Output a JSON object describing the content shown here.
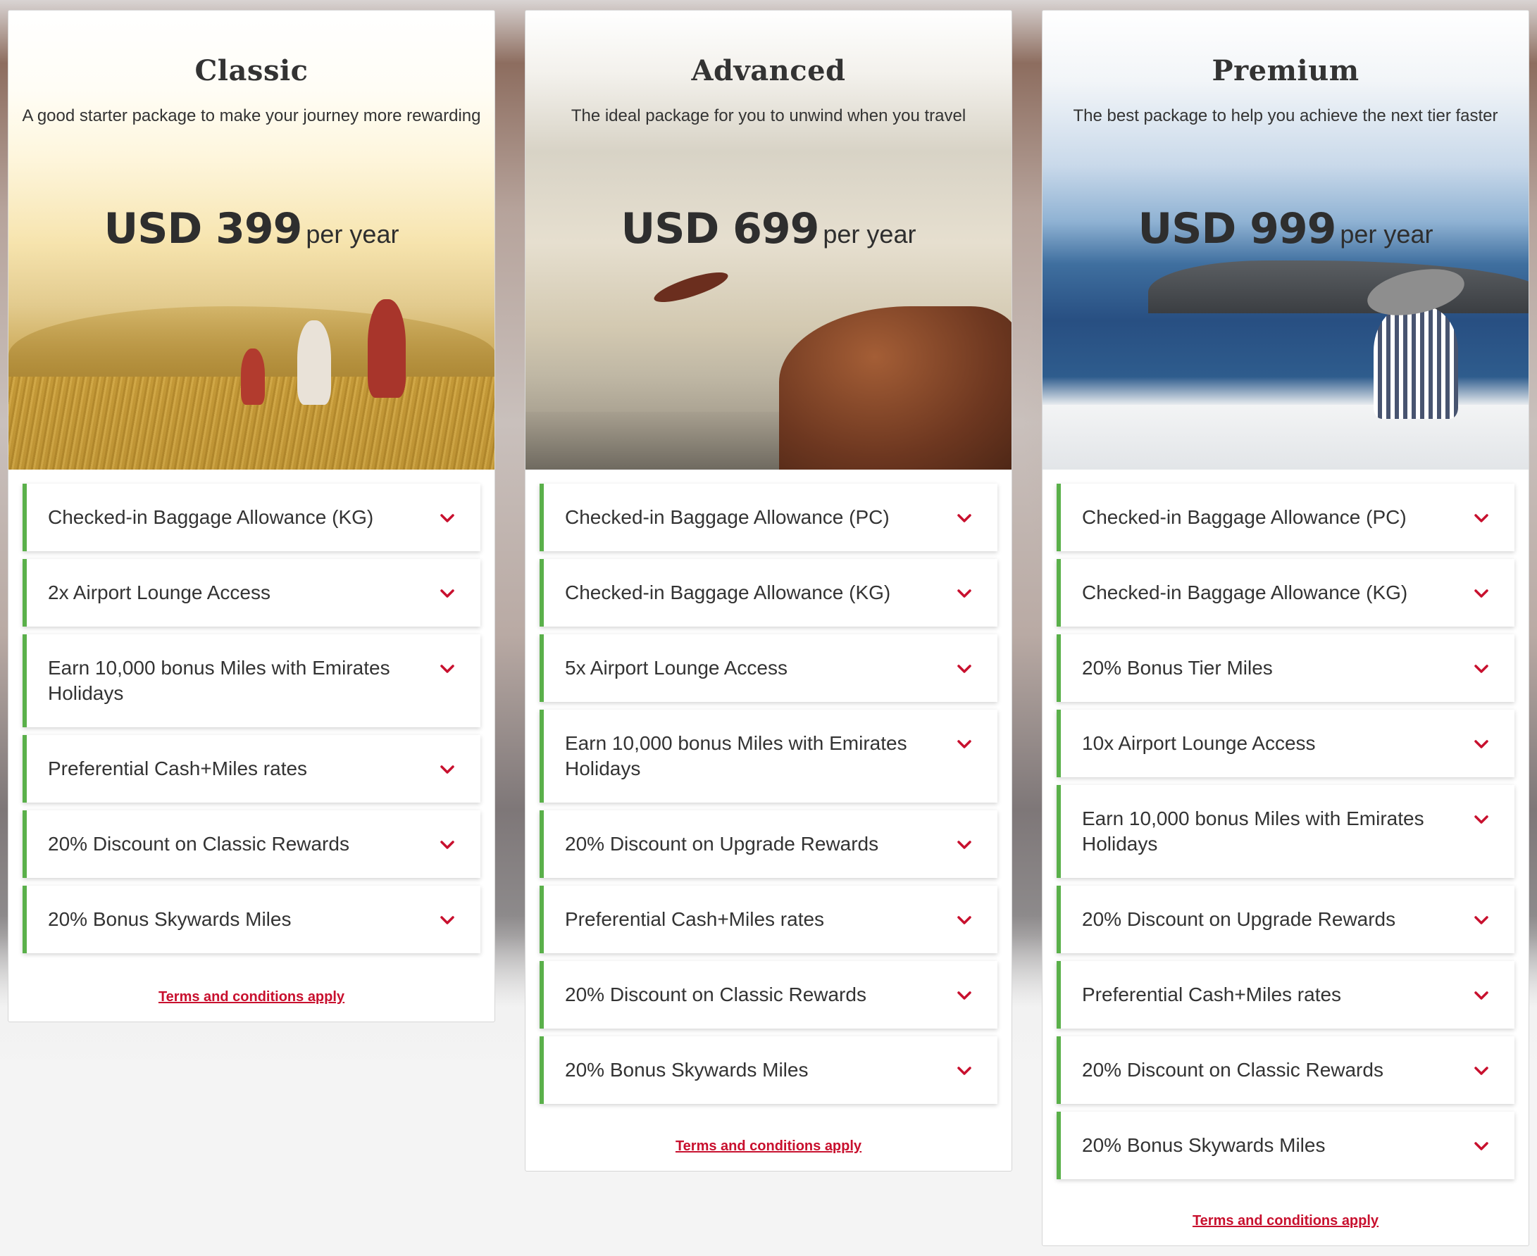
{
  "colors": {
    "accent_green": "#5ab04a",
    "accent_red": "#c8102e",
    "text": "#333333"
  },
  "icons": {
    "benefit_toggle": "chevron-down-icon"
  },
  "packages": [
    {
      "title": "Classic",
      "subtitle": "A good starter package to make your journey more rewarding",
      "price": "USD 399",
      "period": "per year",
      "benefits": [
        "Checked-in Baggage Allowance (KG)",
        "2x Airport Lounge Access",
        "Earn 10,000 bonus Miles with Emirates Holidays",
        "Preferential Cash+Miles rates",
        "20% Discount on Classic Rewards",
        "20% Bonus Skywards Miles"
      ],
      "terms": "Terms and conditions apply"
    },
    {
      "title": "Advanced",
      "subtitle": "The ideal package for you to unwind when you travel",
      "price": "USD 699",
      "period": "per year",
      "benefits": [
        "Checked-in Baggage Allowance (PC)",
        "Checked-in Baggage Allowance (KG)",
        "5x Airport Lounge Access",
        "Earn 10,000 bonus Miles with Emirates Holidays",
        "20% Discount on Upgrade Rewards",
        "Preferential Cash+Miles rates",
        "20% Discount on Classic Rewards",
        "20% Bonus Skywards Miles"
      ],
      "terms": "Terms and conditions apply"
    },
    {
      "title": "Premium",
      "subtitle": "The best package to help you achieve the next tier faster",
      "price": "USD 999",
      "period": "per year",
      "benefits": [
        "Checked-in Baggage Allowance (PC)",
        "Checked-in Baggage Allowance (KG)",
        "20% Bonus Tier Miles",
        "10x Airport Lounge Access",
        "Earn 10,000 bonus Miles with Emirates Holidays",
        "20% Discount on Upgrade Rewards",
        "Preferential Cash+Miles rates",
        "20% Discount on Classic Rewards",
        "20% Bonus Skywards Miles"
      ],
      "terms": "Terms and conditions apply"
    }
  ]
}
